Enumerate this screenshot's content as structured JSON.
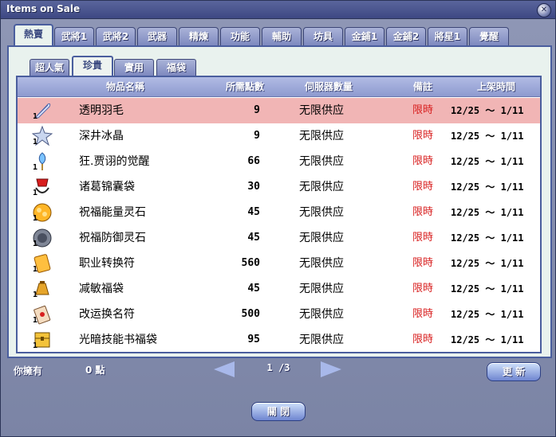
{
  "window": {
    "title": "Items on Sale"
  },
  "tabs": [
    {
      "label": "熱賣"
    },
    {
      "label": "武將1"
    },
    {
      "label": "武將2"
    },
    {
      "label": "武器"
    },
    {
      "label": "精煉"
    },
    {
      "label": "功能"
    },
    {
      "label": "輔助"
    },
    {
      "label": "坊具"
    },
    {
      "label": "金鋪1"
    },
    {
      "label": "金鋪2"
    },
    {
      "label": "將星1"
    },
    {
      "label": "覺醒"
    }
  ],
  "subtabs": [
    {
      "label": "超人氣"
    },
    {
      "label": "珍貴"
    },
    {
      "label": "實用"
    },
    {
      "label": "福袋"
    }
  ],
  "table": {
    "headers": {
      "name": "物品名稱",
      "price": "所需點數",
      "stock": "伺服器數量",
      "note": "備註",
      "period": "上架時間"
    },
    "rows": [
      {
        "name": "透明羽毛",
        "qty": "1",
        "price": "9",
        "stock": "无限供应",
        "note": "限時",
        "period": "12/25 ～ 1/11",
        "icon": "feather-icon"
      },
      {
        "name": "深井冰晶",
        "qty": "1",
        "price": "9",
        "stock": "无限供应",
        "note": "限時",
        "period": "12/25 ～ 1/11",
        "icon": "ice-crystal-icon"
      },
      {
        "name": "狂.贾诩的觉醒",
        "qty": "1",
        "price": "66",
        "stock": "无限供应",
        "note": "限時",
        "period": "12/25 ～ 1/11",
        "icon": "awakening-gem-icon"
      },
      {
        "name": "诸葛锦囊袋",
        "qty": "1",
        "price": "30",
        "stock": "无限供应",
        "note": "限時",
        "period": "12/25 ～ 1/11",
        "icon": "brocade-bag-icon"
      },
      {
        "name": "祝福能量灵石",
        "qty": "1",
        "price": "45",
        "stock": "无限供应",
        "note": "限時",
        "period": "12/25 ～ 1/11",
        "icon": "energy-stone-icon"
      },
      {
        "name": "祝福防御灵石",
        "qty": "1",
        "price": "45",
        "stock": "无限供应",
        "note": "限時",
        "period": "12/25 ～ 1/11",
        "icon": "defense-stone-icon"
      },
      {
        "name": "职业转换符",
        "qty": "1",
        "price": "560",
        "stock": "无限供应",
        "note": "限時",
        "period": "12/25 ～ 1/11",
        "icon": "talisman-icon"
      },
      {
        "name": "减敏福袋",
        "qty": "1",
        "price": "45",
        "stock": "无限供应",
        "note": "限時",
        "period": "12/25 ～ 1/11",
        "icon": "lucky-bag-icon"
      },
      {
        "name": "改运换名符",
        "qty": "1",
        "price": "500",
        "stock": "无限供应",
        "note": "限時",
        "period": "12/25 ～ 1/11",
        "icon": "rename-card-icon"
      },
      {
        "name": "光暗技能书福袋",
        "qty": "1",
        "price": "95",
        "stock": "无限供应",
        "note": "限時",
        "period": "12/25 ～ 1/11",
        "icon": "skill-book-box-icon"
      }
    ]
  },
  "footer": {
    "owned_label": "你擁有",
    "points": "0 點",
    "page": "1 /3",
    "refresh_label": "更 新",
    "close_label": "關 閉"
  },
  "colors": {
    "selected_row": "#f1b5b5",
    "note_red": "#d81e1e",
    "panel": "#e9f2ee",
    "frame": "#4a5e9e"
  }
}
